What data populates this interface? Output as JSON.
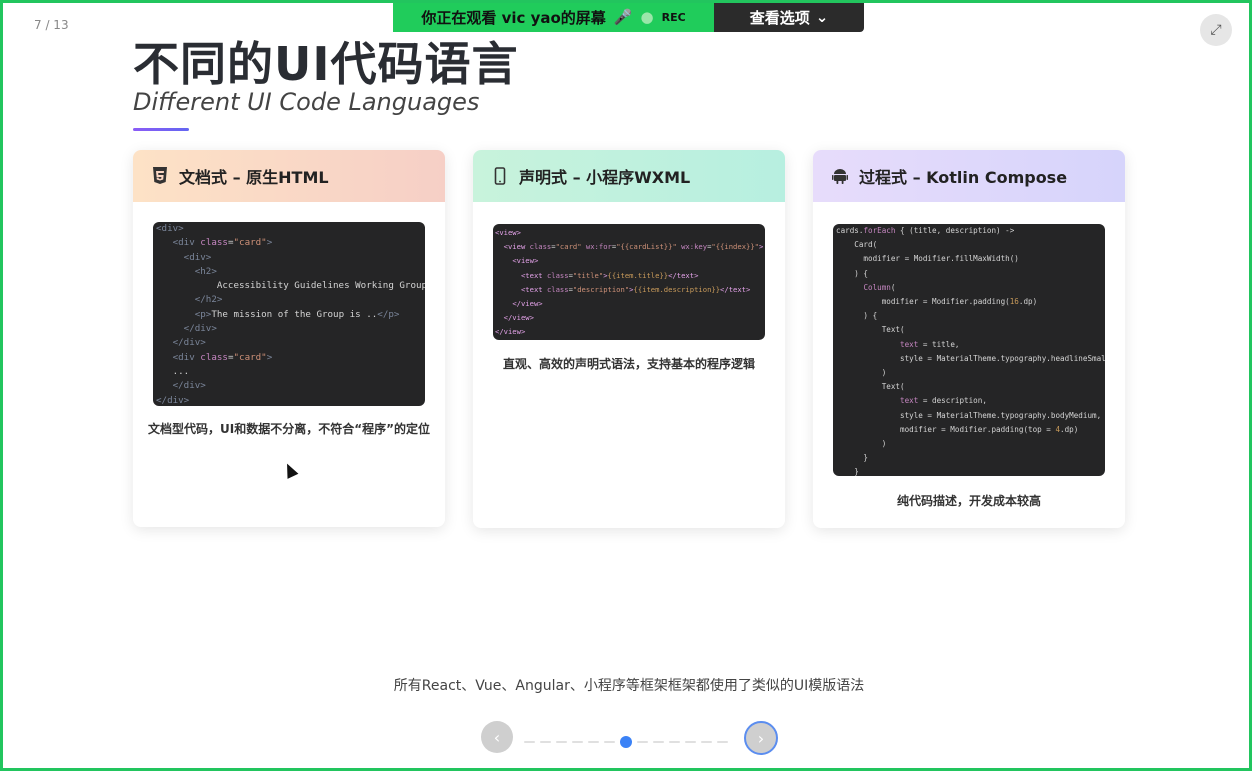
{
  "screen_share": {
    "banner": "你正在观看 vic yao的屏幕",
    "rec": "REC",
    "view_options": "查看选项",
    "colors": {
      "banner_bg": "#20cc5b",
      "options_bg": "#2b2b2b",
      "frame": "#22c55e"
    }
  },
  "slide": {
    "page_counter": "7 / 13",
    "title_cn": "不同的UI代码语言",
    "title_en": "Different UI Code Languages",
    "cards": [
      {
        "icon": "html5-icon",
        "heading": "文档式 – 原生HTML",
        "caption": "文档型代码，UI和数据不分离，不符合“程序”的定位"
      },
      {
        "icon": "mobile-phone-icon",
        "heading": "声明式 – 小程序WXML",
        "caption": "直观、高效的声明式语法，支持基本的程序逻辑"
      },
      {
        "icon": "android-icon",
        "heading": "过程式 – Kotlin Compose",
        "caption": "纯代码描述，开发成本较高"
      }
    ],
    "footer_text": "所有React、Vue、Angular、小程序等框架框架都使用了类似的UI模版语法",
    "pagination": {
      "total_dots": 13,
      "active_index": 6
    }
  }
}
